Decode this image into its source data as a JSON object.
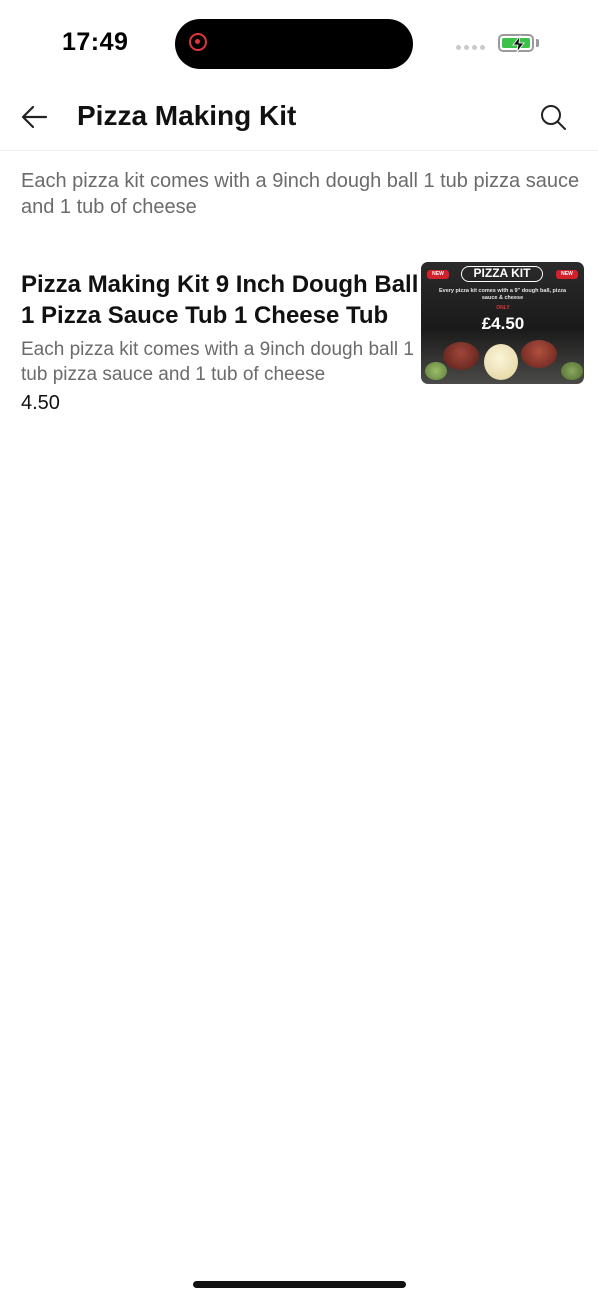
{
  "status_bar": {
    "time": "17:49"
  },
  "header": {
    "title": "Pizza Making Kit",
    "back_icon": "arrow-left-icon",
    "search_icon": "search-icon"
  },
  "category": {
    "description": "Each pizza kit comes with a 9inch dough ball 1 tub pizza sauce and 1 tub of cheese"
  },
  "products": [
    {
      "name": "Pizza Making Kit 9 Inch Dough Ball 1 Pizza Sauce Tub 1 Cheese Tub",
      "description": "Each pizza kit comes with a 9inch dough ball 1 tub pizza sauce and 1 tub of cheese",
      "price": "4.50",
      "image": {
        "badge_left": "NEW",
        "badge_right": "NEW",
        "title": "PIZZA KIT",
        "subtitle": "Every pizza kit comes with a 9\" dough ball, pizza sauce & cheese",
        "only_label": "ONLY",
        "price": "£4.50"
      }
    }
  ],
  "colors": {
    "record_red": "#e0353b",
    "battery_green": "#3cc24a",
    "secondary_text": "#6b6b6b"
  }
}
